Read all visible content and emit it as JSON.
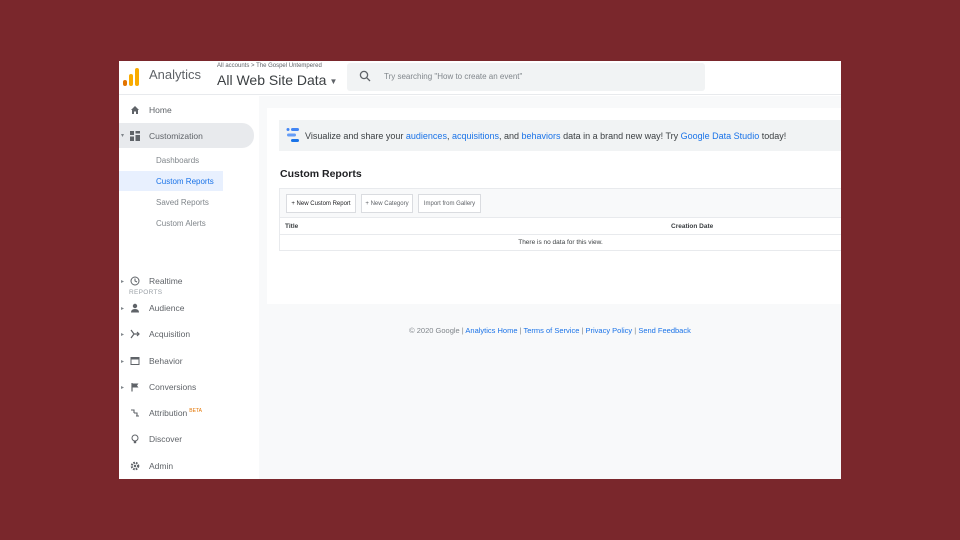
{
  "header": {
    "app_name": "Analytics",
    "breadcrumb": "All accounts > The Gospel Untempered",
    "account_view": "All Web Site Data",
    "search_placeholder": "Try searching \"How to create an event\""
  },
  "sidebar": {
    "home": "Home",
    "customization": "Customization",
    "sub_items": [
      "Dashboards",
      "Custom Reports",
      "Saved Reports",
      "Custom Alerts"
    ],
    "selected_sub": "Custom Reports",
    "reports_section": "REPORTS",
    "reports": {
      "realtime": "Realtime",
      "audience": "Audience",
      "acquisition": "Acquisition",
      "behavior": "Behavior",
      "conversions": "Conversions",
      "attribution": "Attribution",
      "attribution_badge": "BETA",
      "discover": "Discover",
      "admin": "Admin"
    }
  },
  "banner": {
    "text_1": "Visualize and share your ",
    "link_audiences": "audiences",
    "sep_1": ", ",
    "link_acquisitions": "acquisitions",
    "sep_2": ", and ",
    "link_behaviors": "behaviors",
    "text_2": " data in a brand new way! Try ",
    "link_studio": "Google Data Studio",
    "text_3": " today!"
  },
  "custom_reports": {
    "title": "Custom Reports",
    "buttons": {
      "new_report": "+ New Custom Report",
      "new_category": "+ New Category",
      "import": "Import from Gallery"
    },
    "columns": [
      "Title",
      "Creation Date"
    ],
    "empty_message": "There is no data for this view."
  },
  "footer": {
    "copyright": "© 2020 Google",
    "sep": " | ",
    "links": [
      "Analytics Home",
      "Terms of Service",
      "Privacy Policy",
      "Send Feedback"
    ]
  },
  "colors": {
    "backdrop": "#7a272c",
    "accent": "#1a73e8",
    "logo_orange": "#e37400",
    "logo_yellow": "#f9ab00"
  }
}
